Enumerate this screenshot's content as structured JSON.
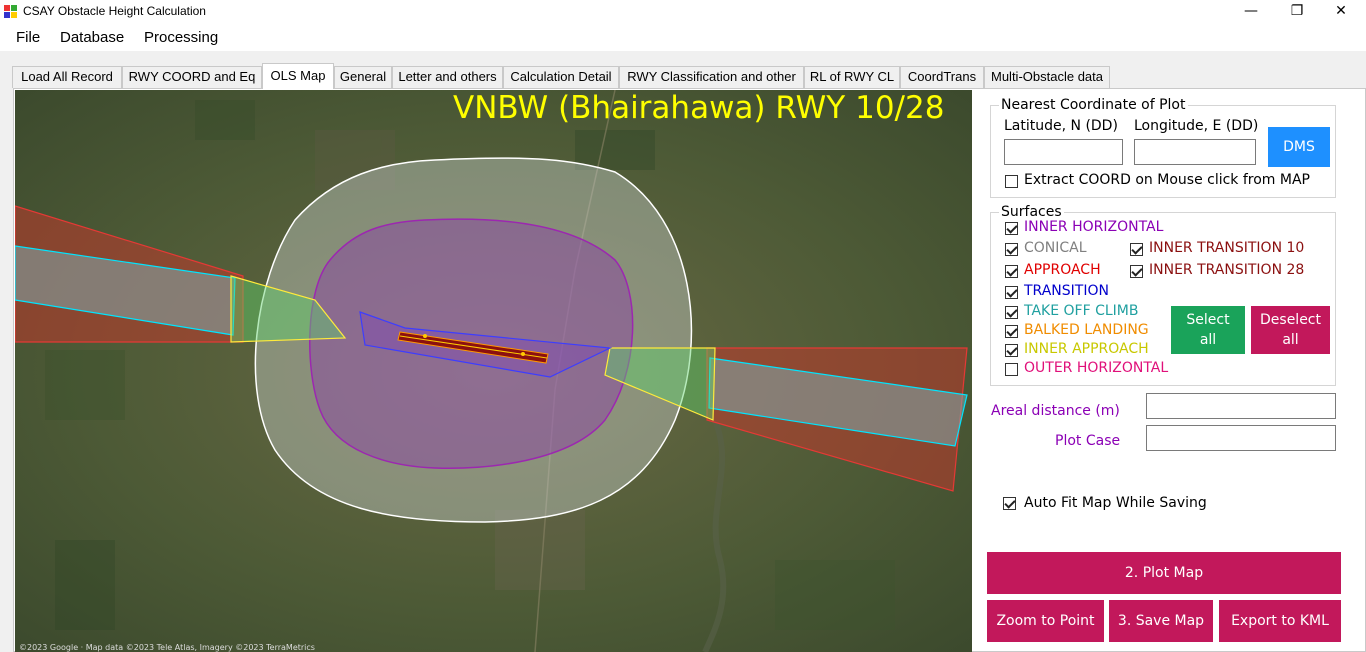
{
  "window": {
    "title": "CSAY Obstacle Height Calculation"
  },
  "menu": [
    "File",
    "Database",
    "Processing"
  ],
  "tabs": [
    "Load All Record",
    "RWY COORD and Eq",
    "OLS Map",
    "General",
    "Letter and others",
    "Calculation Detail",
    "RWY Classification and other",
    "RL of RWY CL",
    "CoordTrans",
    "Multi-Obstacle data"
  ],
  "active_tab": "OLS Map",
  "map": {
    "title": "VNBW (Bhairahawa) RWY 10/28",
    "attribution": "©2023 Google · Map data ©2023 Tele Atlas, Imagery ©2023 TerraMetrics"
  },
  "nearest": {
    "legend": "Nearest Coordinate of Plot",
    "lat_label": "Latitude, N (DD)",
    "lon_label": "Longitude, E (DD)",
    "lat_value": "",
    "lon_value": "",
    "dms_button": "DMS",
    "extract_label": "Extract COORD on Mouse click from MAP",
    "extract_checked": false
  },
  "surfaces": {
    "legend": "Surfaces",
    "items": [
      {
        "label": "INNER HORIZONTAL",
        "color": "#8b00b5",
        "checked": true
      },
      {
        "label": "CONICAL",
        "color": "#808080",
        "checked": true
      },
      {
        "label": "INNER TRANSITION 10",
        "color": "#8b1010",
        "checked": true
      },
      {
        "label": "APPROACH",
        "color": "#e00000",
        "checked": true
      },
      {
        "label": "INNER TRANSITION 28",
        "color": "#8b1010",
        "checked": true
      },
      {
        "label": "TRANSITION",
        "color": "#0000cc",
        "checked": true
      },
      {
        "label": "TAKE OFF CLIMB",
        "color": "#20a0a0",
        "checked": true
      },
      {
        "label": "BALKED LANDING",
        "color": "#f08c00",
        "checked": true
      },
      {
        "label": "INNER APPROACH",
        "color": "#c8c800",
        "checked": true
      },
      {
        "label": "OUTER HORIZONTAL",
        "color": "#e0107a",
        "checked": false
      }
    ],
    "select_all": "Select all",
    "deselect_all": "Deselect all"
  },
  "areal_distance": {
    "label": "Areal distance (m)",
    "value": ""
  },
  "plot_case": {
    "label": "Plot Case",
    "value": ""
  },
  "auto_fit": {
    "label": "Auto Fit Map While Saving",
    "checked": true
  },
  "buttons": {
    "plot_map": "2. Plot Map",
    "zoom": "Zoom to Point",
    "save": "3. Save Map",
    "export": "Export to KML"
  },
  "colors": {
    "accent_blue": "#1e90ff",
    "accent_green": "#1aa35a",
    "accent_red": "#c2185b",
    "map_title": "#ffff00"
  }
}
